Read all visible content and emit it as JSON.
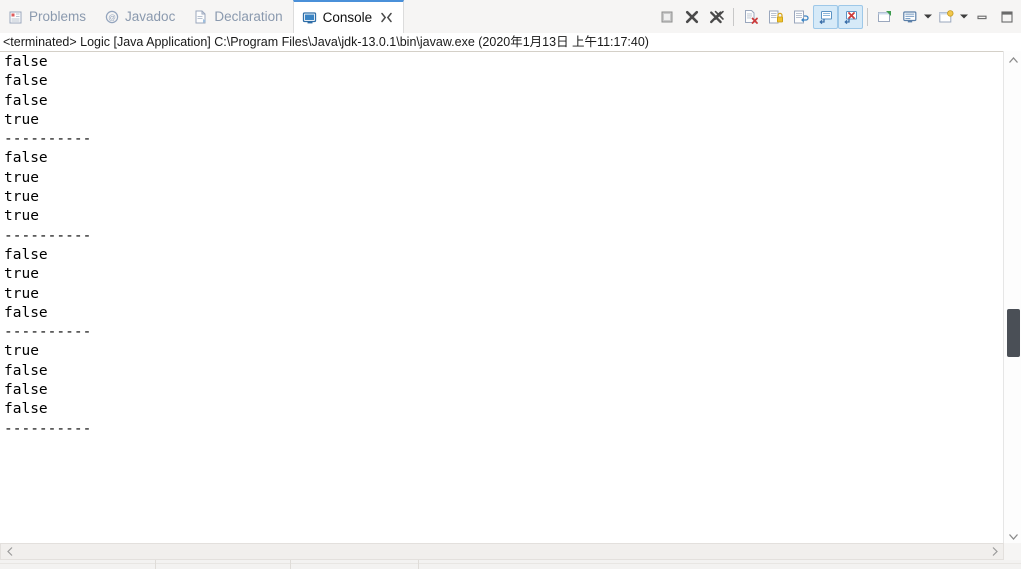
{
  "window": {
    "title": "Console"
  },
  "tabs": [
    {
      "label": "Problems",
      "icon": "problems-icon",
      "active": false
    },
    {
      "label": "Javadoc",
      "icon": "javadoc-icon",
      "active": false
    },
    {
      "label": "Declaration",
      "icon": "declaration-icon",
      "active": false
    },
    {
      "label": "Console",
      "icon": "console-icon",
      "active": true,
      "closable": true
    }
  ],
  "toolbar": {
    "buttons": [
      {
        "name": "terminate-all-icon",
        "title": "Terminate All",
        "toggled": false
      },
      {
        "name": "remove-launch-icon",
        "title": "Remove Launch",
        "toggled": false
      },
      {
        "name": "remove-all-terminated-icon",
        "title": "Remove All Terminated Launches",
        "toggled": false
      },
      {
        "name": "clear-console-icon",
        "title": "Clear Console",
        "toggled": false
      },
      {
        "name": "scroll-lock-icon",
        "title": "Scroll Lock",
        "toggled": false
      },
      {
        "name": "word-wrap-icon",
        "title": "Word Wrap",
        "toggled": false
      },
      {
        "name": "show-console-on-output-icon",
        "title": "Show Console When Standard Out Changes",
        "toggled": true
      },
      {
        "name": "show-console-on-error-icon",
        "title": "Show Console When Standard Error Changes",
        "toggled": true
      },
      {
        "name": "pin-console-icon",
        "title": "Pin Console",
        "toggled": false
      },
      {
        "name": "display-selected-console-icon",
        "title": "Display Selected Console",
        "toggled": false
      },
      {
        "name": "open-console-icon",
        "title": "Open Console",
        "toggled": false
      },
      {
        "name": "minimize-icon",
        "title": "Minimize",
        "toggled": false
      },
      {
        "name": "maximize-icon",
        "title": "Maximize",
        "toggled": false
      }
    ]
  },
  "process_line": {
    "status": "<terminated>",
    "text": "<terminated> Logic [Java Application] C:\\Program Files\\Java\\jdk-13.0.1\\bin\\javaw.exe (2020年1月13日 上午11:17:40)"
  },
  "console": {
    "separator": "----------",
    "lines": [
      "false",
      "false",
      "false",
      "true",
      "----------",
      "false",
      "true",
      "true",
      "true",
      "----------",
      "false",
      "true",
      "true",
      "false",
      "----------",
      "true",
      "false",
      "false",
      "false",
      "----------"
    ],
    "output_text": "false\nfalse\nfalse\ntrue\n----------\nfalse\ntrue\ntrue\ntrue\n----------\nfalse\ntrue\ntrue\nfalse\n----------\ntrue\nfalse\nfalse\nfalse\n----------"
  },
  "scrollbars": {
    "vertical": {
      "up_arrow": "▲",
      "down_arrow": "▼",
      "thumb_position_pct": 52
    },
    "horizontal": {
      "left_arrow": "‹",
      "right_arrow": "›"
    }
  },
  "colors": {
    "tab_active_accent": "#4a90d9",
    "tab_inactive_text": "#8a99ae",
    "console_bg": "#ffffff",
    "console_text": "#000000",
    "toolbar_toggle_bg": "#d6eaf8",
    "scroll_thumb": "#4a4f56"
  }
}
